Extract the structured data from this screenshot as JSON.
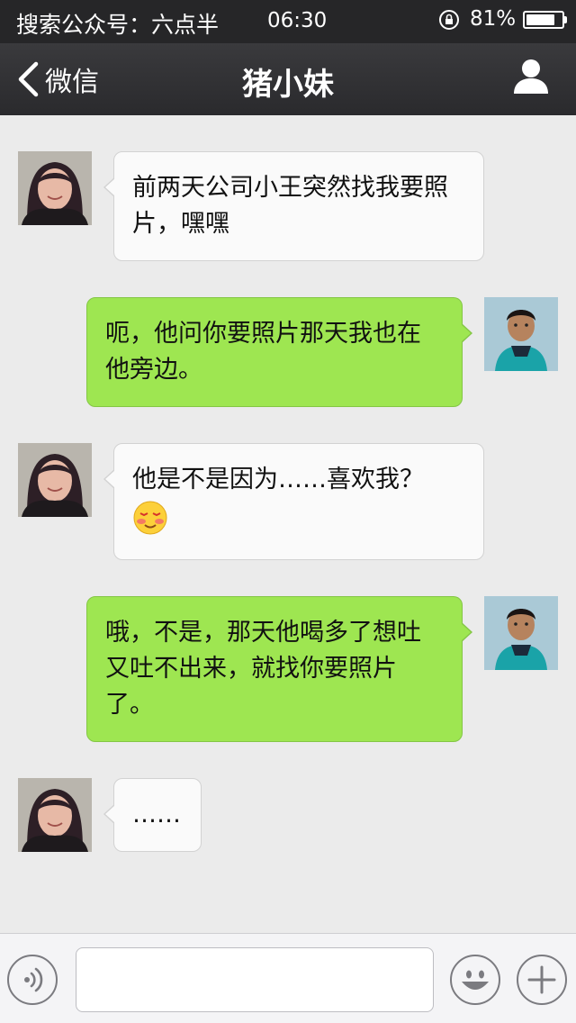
{
  "status_bar": {
    "carrier_text": "搜索公众号：六点半",
    "time": "06:30",
    "battery_percent_text": "81%",
    "battery_level": 0.81,
    "lock_icon": "orientation-lock-icon"
  },
  "nav": {
    "back_label": "微信",
    "title": "猪小妹",
    "back_icon": "chevron-left-icon",
    "profile_icon": "person-icon"
  },
  "messages": [
    {
      "side": "in",
      "text": "前两天公司小王突然找我要照片，嘿嘿"
    },
    {
      "side": "out",
      "text": "呃，他问你要照片那天我也在他旁边。"
    },
    {
      "side": "in",
      "text": "他是不是因为……喜欢我？",
      "emoji": "blushing-face-emoji"
    },
    {
      "side": "out",
      "text": "哦，不是，那天他喝多了想吐又吐不出来，就找你要照片了。"
    },
    {
      "side": "in",
      "text": "……"
    }
  ],
  "input_bar": {
    "voice_icon": "voice-icon",
    "input_value": "",
    "emoji_icon": "smiley-icon",
    "plus_icon": "plus-icon"
  },
  "colors": {
    "nav_bg": "#2e2e31",
    "chat_bg": "#ebebeb",
    "incoming_bubble": "#fafafa",
    "outgoing_bubble": "#9ee651"
  }
}
